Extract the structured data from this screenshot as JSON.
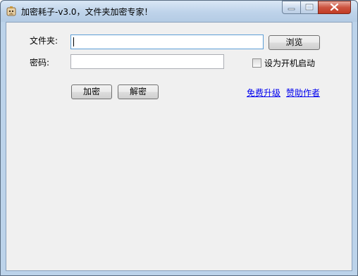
{
  "window": {
    "title": "加密耗子-v3.0，文件夹加密专家！"
  },
  "form": {
    "folder_label": "文件夹:",
    "folder_value": "",
    "browse_label": "浏览",
    "password_label": "密码:",
    "password_value": "",
    "autostart_label": "设为开机启动",
    "autostart_checked": false,
    "encrypt_label": "加密",
    "decrypt_label": "解密"
  },
  "links": {
    "upgrade": "免费升级",
    "sponsor": "赞助作者"
  },
  "icons": {
    "app": "app-mouse-icon",
    "minimize": "minimize-icon",
    "maximize": "maximize-icon",
    "close": "close-icon"
  }
}
